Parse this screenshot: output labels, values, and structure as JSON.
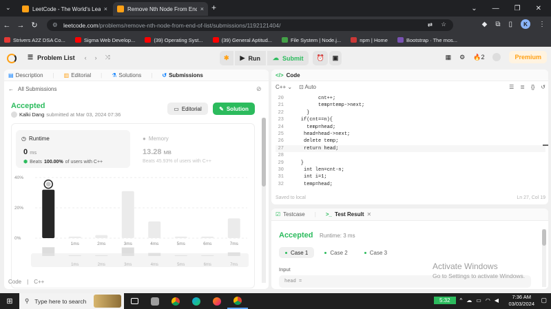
{
  "browser": {
    "tabs": [
      {
        "title": "LeetCode - The World's Leadin",
        "close": "×"
      },
      {
        "title": "Remove Nth Node From End of",
        "close": "×"
      }
    ],
    "new_tab": "+",
    "window_controls": [
      "⌄",
      "—",
      "❐",
      "✕"
    ],
    "url_host": "leetcode.com",
    "url_path": "/problems/remove-nth-node-from-end-of-list/submissions/1192121404/",
    "profile_initial": "K",
    "bookmarks": [
      {
        "label": "Strivers A2Z DSA Co...",
        "color": "#e53935"
      },
      {
        "label": "Sigma Web Develop...",
        "color": "#ff0000"
      },
      {
        "label": "(39) Operating Syst...",
        "color": "#ff0000"
      },
      {
        "label": "(39) General Aptitud...",
        "color": "#ff0000"
      },
      {
        "label": "File System | Node.j...",
        "color": "#43a047"
      },
      {
        "label": "npm | Home",
        "color": "#cb3837"
      },
      {
        "label": "Bootstrap · The mos...",
        "color": "#7952b3"
      }
    ]
  },
  "topbar": {
    "problem_list": "Problem List",
    "run": "Run",
    "submit": "Submit",
    "streak": "2",
    "premium": "Premium"
  },
  "left": {
    "tabs": [
      "Description",
      "Editorial",
      "Solutions",
      "Submissions"
    ],
    "all_submissions": "All Submissions",
    "status": "Accepted",
    "author": "Kalki Dang",
    "submitted": "submitted at Mar 03, 2024 07:36",
    "editorial_btn": "Editorial",
    "solution_btn": "Solution",
    "runtime": {
      "title": "Runtime",
      "value": "0",
      "unit": "ms",
      "beats_label": "Beats",
      "beats_pct": "100.00%",
      "beats_suffix": "of users with C++"
    },
    "memory": {
      "title": "Memory",
      "value": "13.28",
      "unit": "MB",
      "beats_text": "Beats 45.93% of users with C++"
    },
    "footer": {
      "code_label": "Code",
      "lang": "C++"
    }
  },
  "chart_data": {
    "type": "bar",
    "categories": [
      "0ms",
      "1ms",
      "2ms",
      "3ms",
      "4ms",
      "5ms",
      "6ms",
      "7ms"
    ],
    "values": [
      32,
      1,
      2,
      31,
      11,
      1,
      1,
      13
    ],
    "highlight_index": 0,
    "ytick_labels": [
      "40%",
      "20%",
      "0%"
    ],
    "yticks": [
      40,
      20,
      0
    ],
    "ylim": [
      0,
      40
    ],
    "xtick_labels": [
      "1ms",
      "2ms",
      "3ms",
      "4ms",
      "5ms",
      "6ms",
      "7ms"
    ],
    "colors": {
      "highlight": "#262626",
      "bar": "#ebebeb"
    }
  },
  "code": {
    "header": "Code",
    "lang": "C++",
    "mode": "Auto",
    "lines": [
      {
        "n": "20",
        "t": "          cnt++;"
      },
      {
        "n": "21",
        "t": "          temp=temp->next;"
      },
      {
        "n": "22",
        "t": "      }"
      },
      {
        "n": "23",
        "t": "    if(cnt==n){"
      },
      {
        "n": "24",
        "t": "      temp=head;"
      },
      {
        "n": "25",
        "t": "     head=head->next;"
      },
      {
        "n": "26",
        "t": "     delete temp;"
      },
      {
        "n": "27",
        "t": "     return head;"
      },
      {
        "n": "28",
        "t": ""
      },
      {
        "n": "29",
        "t": "    }"
      },
      {
        "n": "30",
        "t": "     int len=cnt-n;"
      },
      {
        "n": "31",
        "t": "     int i=1;"
      },
      {
        "n": "32",
        "t": "     temp=head;"
      }
    ],
    "saved": "Saved to local",
    "cursor": "Ln 27, Col 19"
  },
  "test": {
    "tabs": [
      "Testcase",
      "Test Result"
    ],
    "status": "Accepted",
    "runtime": "Runtime: 3 ms",
    "cases": [
      "Case 1",
      "Case 2",
      "Case 3"
    ],
    "input_label": "Input",
    "input_value": "head ="
  },
  "watermark": {
    "title": "Activate Windows",
    "subtitle": "Go to Settings to activate Windows."
  },
  "taskbar": {
    "search": "Type here to search",
    "timer": "5:32",
    "time": "7:36 AM",
    "date": "03/03/2024"
  }
}
